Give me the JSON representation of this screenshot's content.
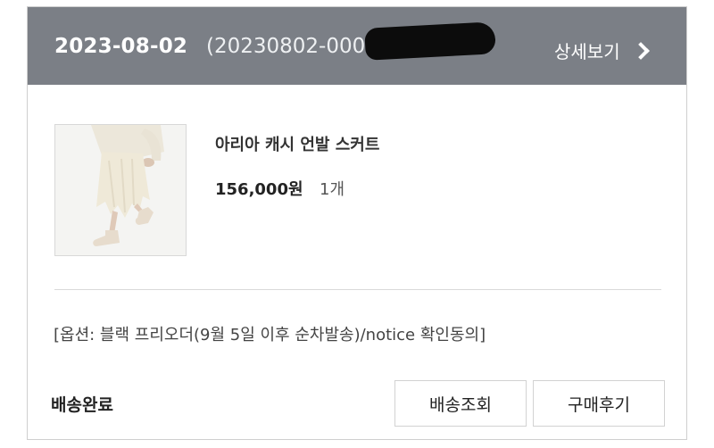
{
  "order": {
    "date": "2023-08-02",
    "number": "(20230802-0000739)"
  },
  "header": {
    "detail_label": "상세보기"
  },
  "product": {
    "image_icon": "product-photo-skirt",
    "name": "아리아 캐시 언발 스커트",
    "price": "156,000원",
    "quantity": "1개",
    "option": "[옵션: 블랙 프리오더(9월 5일 이후 순차발송)/notice 확인동의]"
  },
  "footer": {
    "status": "배송완료",
    "tracking_label": "배송조회",
    "review_label": "구매후기"
  },
  "colors": {
    "header_bg": "#7b7f86",
    "border": "#cfcfcf"
  }
}
